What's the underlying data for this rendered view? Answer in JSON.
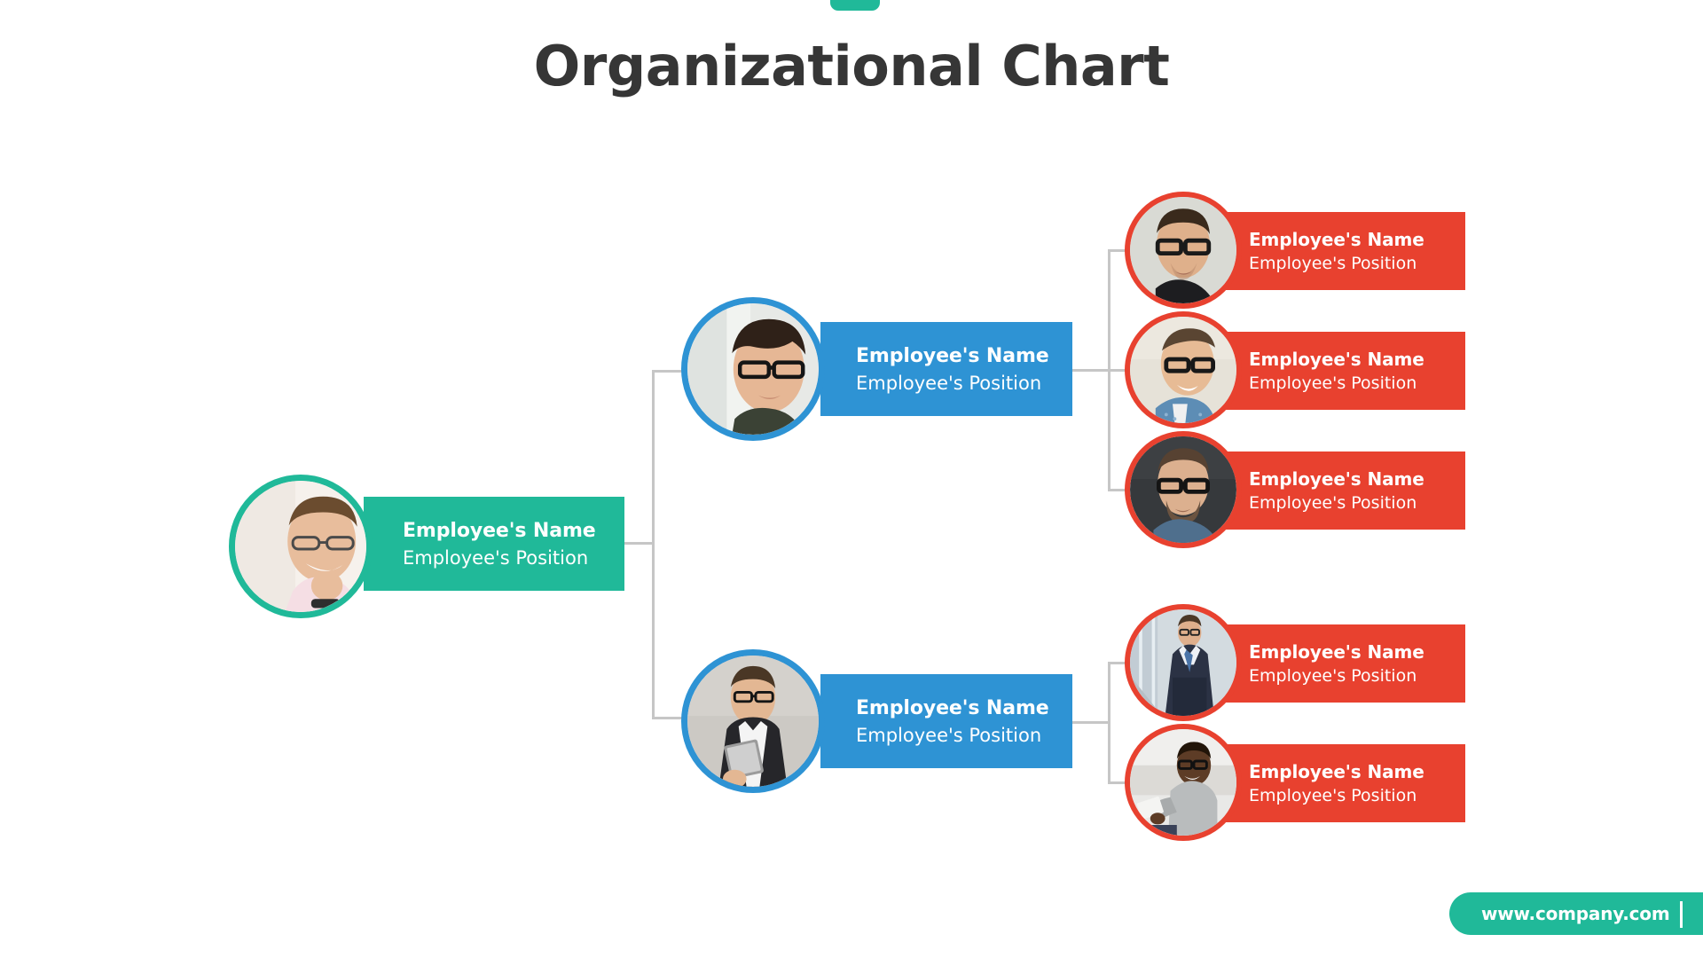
{
  "header": {
    "title": "Organizational Chart",
    "accent_color": "#20b999"
  },
  "colors": {
    "root": "#20b999",
    "manager": "#2e93d4",
    "employee": "#e8412f",
    "title_text": "#363636",
    "connector": "#c6c6c6",
    "card_text": "#ffffff",
    "background": "#ffffff"
  },
  "chart_data": {
    "type": "diagram",
    "title": "Organizational Chart",
    "layout": "horizontal-tree-left-to-right",
    "levels": 3,
    "node_counts": {
      "root": 1,
      "managers": 2,
      "employees": 5
    },
    "nodes": [
      {
        "id": "root",
        "level": 0,
        "color": "#20b999",
        "name": "Employee's Name",
        "position": "Employee's Position",
        "photo": "portrait-smiling-man-glasses-pink-shirt",
        "children": [
          "manager-1",
          "manager-2"
        ]
      },
      {
        "id": "manager-1",
        "level": 1,
        "color": "#2e93d4",
        "name": "Employee's Name",
        "position": "Employee's Position",
        "photo": "portrait-young-man-black-glasses-window",
        "parent": "root",
        "children": [
          "employee-1",
          "employee-2",
          "employee-3"
        ]
      },
      {
        "id": "manager-2",
        "level": 1,
        "color": "#2e93d4",
        "name": "Employee's Name",
        "position": "Employee's Position",
        "photo": "portrait-man-suit-holding-laptop",
        "parent": "root",
        "children": [
          "employee-4",
          "employee-5"
        ]
      },
      {
        "id": "employee-1",
        "level": 2,
        "color": "#e8412f",
        "name": "Employee's Name",
        "position": "Employee's Position",
        "photo": "portrait-man-thick-glasses-gray-backdrop",
        "parent": "manager-1"
      },
      {
        "id": "employee-2",
        "level": 2,
        "color": "#e8412f",
        "name": "Employee's Name",
        "position": "Employee's Position",
        "photo": "portrait-man-denim-shirt-side-profile",
        "parent": "manager-1"
      },
      {
        "id": "employee-3",
        "level": 2,
        "color": "#e8412f",
        "name": "Employee's Name",
        "position": "Employee's Position",
        "photo": "portrait-bearded-man-glasses-dark-backdrop",
        "parent": "manager-1"
      },
      {
        "id": "employee-4",
        "level": 2,
        "color": "#e8412f",
        "name": "Employee's Name",
        "position": "Employee's Position",
        "photo": "businessman-suit-standing-escalator",
        "parent": "manager-2"
      },
      {
        "id": "employee-5",
        "level": 2,
        "color": "#e8412f",
        "name": "Employee's Name",
        "position": "Employee's Position",
        "photo": "man-gray-polo-glasses-seated-tablet",
        "parent": "manager-2"
      }
    ]
  },
  "footer": {
    "url": "www.company.com"
  }
}
